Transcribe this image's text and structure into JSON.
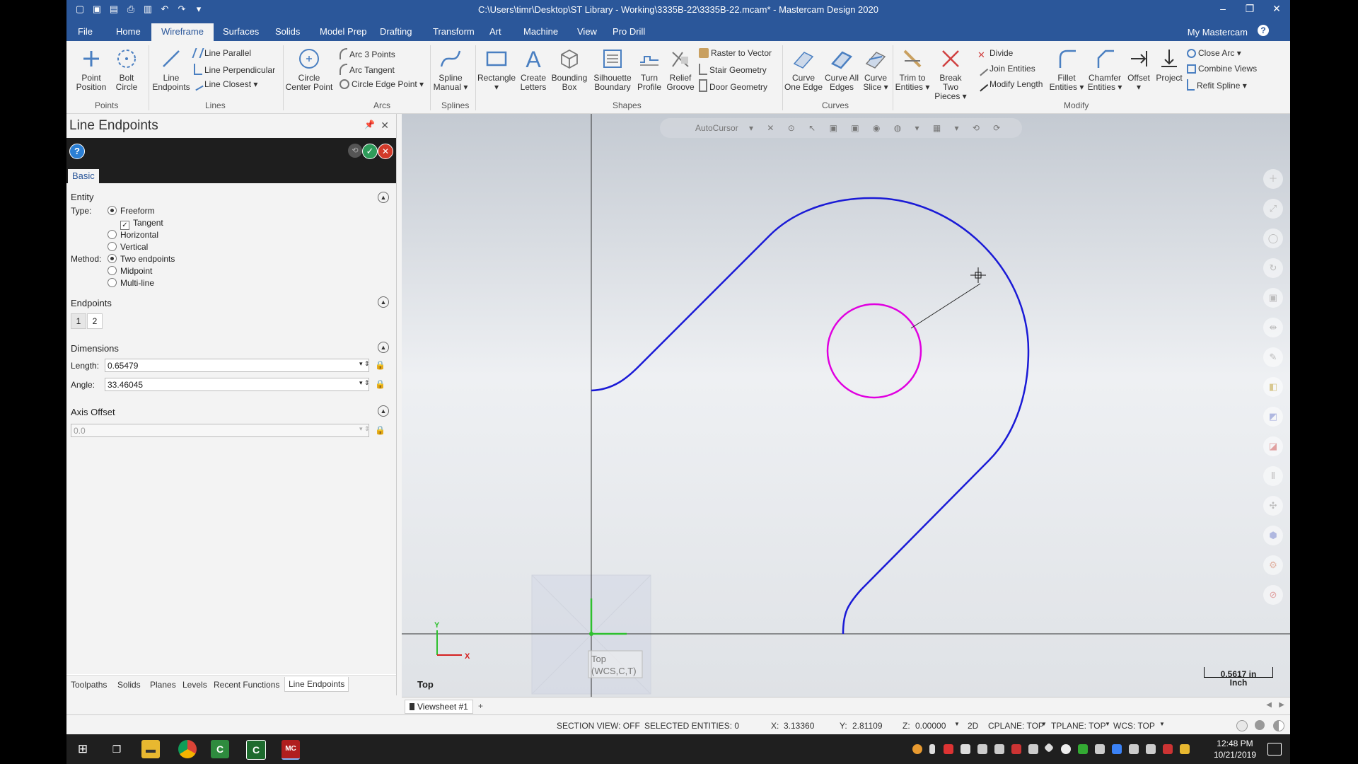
{
  "window": {
    "title": "C:\\Users\\timr\\Desktop\\ST Library - Working\\3335B-22\\3335B-22.mcam* - Mastercam Design 2020"
  },
  "menu": {
    "tabs": [
      "File",
      "Home",
      "Wireframe",
      "Surfaces",
      "Solids",
      "Model Prep",
      "Drafting",
      "Transform",
      "Art",
      "Machine",
      "View",
      "Pro Drill"
    ],
    "active": "Wireframe",
    "account": "My Mastercam"
  },
  "ribbon": {
    "point_position": "Point Position",
    "bolt_circle": "Bolt Circle",
    "line_endpoints": "Line Endpoints",
    "line_parallel": "Line Parallel",
    "line_perpendicular": "Line Perpendicular",
    "line_closest": "Line Closest",
    "circle_center_point": "Circle Center Point",
    "arc_3_points": "Arc 3 Points",
    "arc_tangent": "Arc Tangent",
    "circle_edge_point": "Circle Edge Point",
    "spline_manual": "Spline Manual",
    "rectangle": "Rectangle",
    "create_letters": "Create Letters",
    "bounding_box": "Bounding Box",
    "silhouette_boundary": "Silhouette Boundary",
    "turn_profile": "Turn Profile",
    "relief_groove": "Relief Groove",
    "raster_to_vector": "Raster to Vector",
    "stair_geometry": "Stair Geometry",
    "door_geometry": "Door Geometry",
    "curve_one_edge": "Curve One Edge",
    "curve_all_edges": "Curve All Edges",
    "curve_slice": "Curve Slice",
    "trim_to_entities": "Trim to Entities",
    "break_two_pieces": "Break Two Pieces",
    "divide": "Divide",
    "join_entities": "Join Entities",
    "modify_length": "Modify Length",
    "fillet_entities": "Fillet Entities",
    "chamfer_entities": "Chamfer Entities",
    "offset": "Offset",
    "project": "Project",
    "close_arc": "Close Arc",
    "combine_views": "Combine Views",
    "refit_spline": "Refit Spline",
    "groups": {
      "points": "Points",
      "lines": "Lines",
      "arcs": "Arcs",
      "splines": "Splines",
      "shapes": "Shapes",
      "curves": "Curves",
      "modify": "Modify"
    }
  },
  "panel": {
    "title": "Line Endpoints",
    "tab": "Basic",
    "entity": {
      "header": "Entity",
      "type_label": "Type:",
      "freeform": "Freeform",
      "tangent": "Tangent",
      "horizontal": "Horizontal",
      "vertical": "Vertical",
      "method_label": "Method:",
      "two_endpoints": "Two endpoints",
      "midpoint": "Midpoint",
      "multi_line": "Multi-line"
    },
    "endpoints": {
      "header": "Endpoints",
      "btn1": "1",
      "btn2": "2"
    },
    "dimensions": {
      "header": "Dimensions",
      "length_label": "Length:",
      "length": "0.65479",
      "angle_label": "Angle:",
      "angle": "33.46045"
    },
    "axis_offset": {
      "header": "Axis Offset",
      "value": "0.0"
    },
    "bottom_tabs": [
      "Toolpaths",
      "Solids",
      "Planes",
      "Levels",
      "Recent Functions",
      "Line Endpoints"
    ]
  },
  "graphics": {
    "autocursor": "AutoCursor",
    "view_label": "Top",
    "plane_label_1": "Top",
    "plane_label_2": "(WCS,C,T)",
    "axis_x": "X",
    "axis_y": "Y",
    "scale_value": "0.5617 in",
    "scale_unit": "Inch",
    "colors": {
      "profile": "#1a1ad6",
      "circle": "#e000e0"
    }
  },
  "viewsheet": {
    "tab": "Viewsheet #1",
    "add": "+"
  },
  "status": {
    "section_view": "SECTION VIEW: OFF",
    "selected": "SELECTED ENTITIES: 0",
    "x_label": "X:",
    "x": "3.13360",
    "y_label": "Y:",
    "y": "2.81109",
    "z_label": "Z:",
    "z": "0.00000",
    "mode": "2D",
    "cplane": "CPLANE: TOP",
    "tplane": "TPLANE: TOP",
    "wcs": "WCS: TOP"
  },
  "taskbar": {
    "time": "12:48 PM",
    "date": "10/21/2019"
  }
}
